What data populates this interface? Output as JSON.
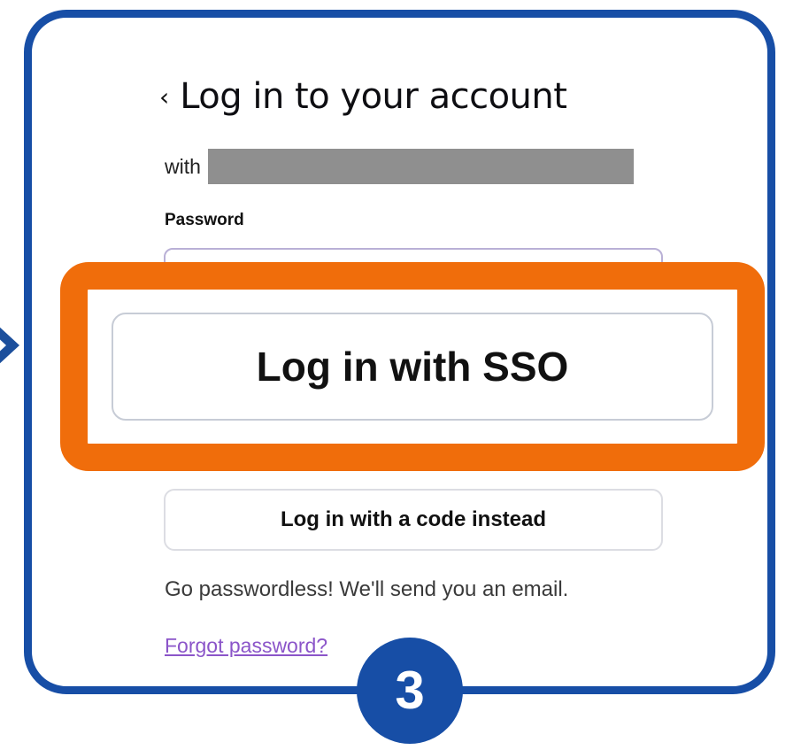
{
  "login": {
    "back_icon": "chevron-left-icon",
    "title": "Log in to your account",
    "with_label": "with",
    "password_label": "Password",
    "sso_button_label": "Log in with SSO",
    "code_button_label": "Log in with a code instead",
    "passwordless_text": "Go passwordless! We'll send you an email.",
    "forgot_link": "Forgot password?"
  },
  "annotation": {
    "step_number": "3",
    "frame_color": "#174ea6",
    "highlight_color": "#f06d0b"
  }
}
